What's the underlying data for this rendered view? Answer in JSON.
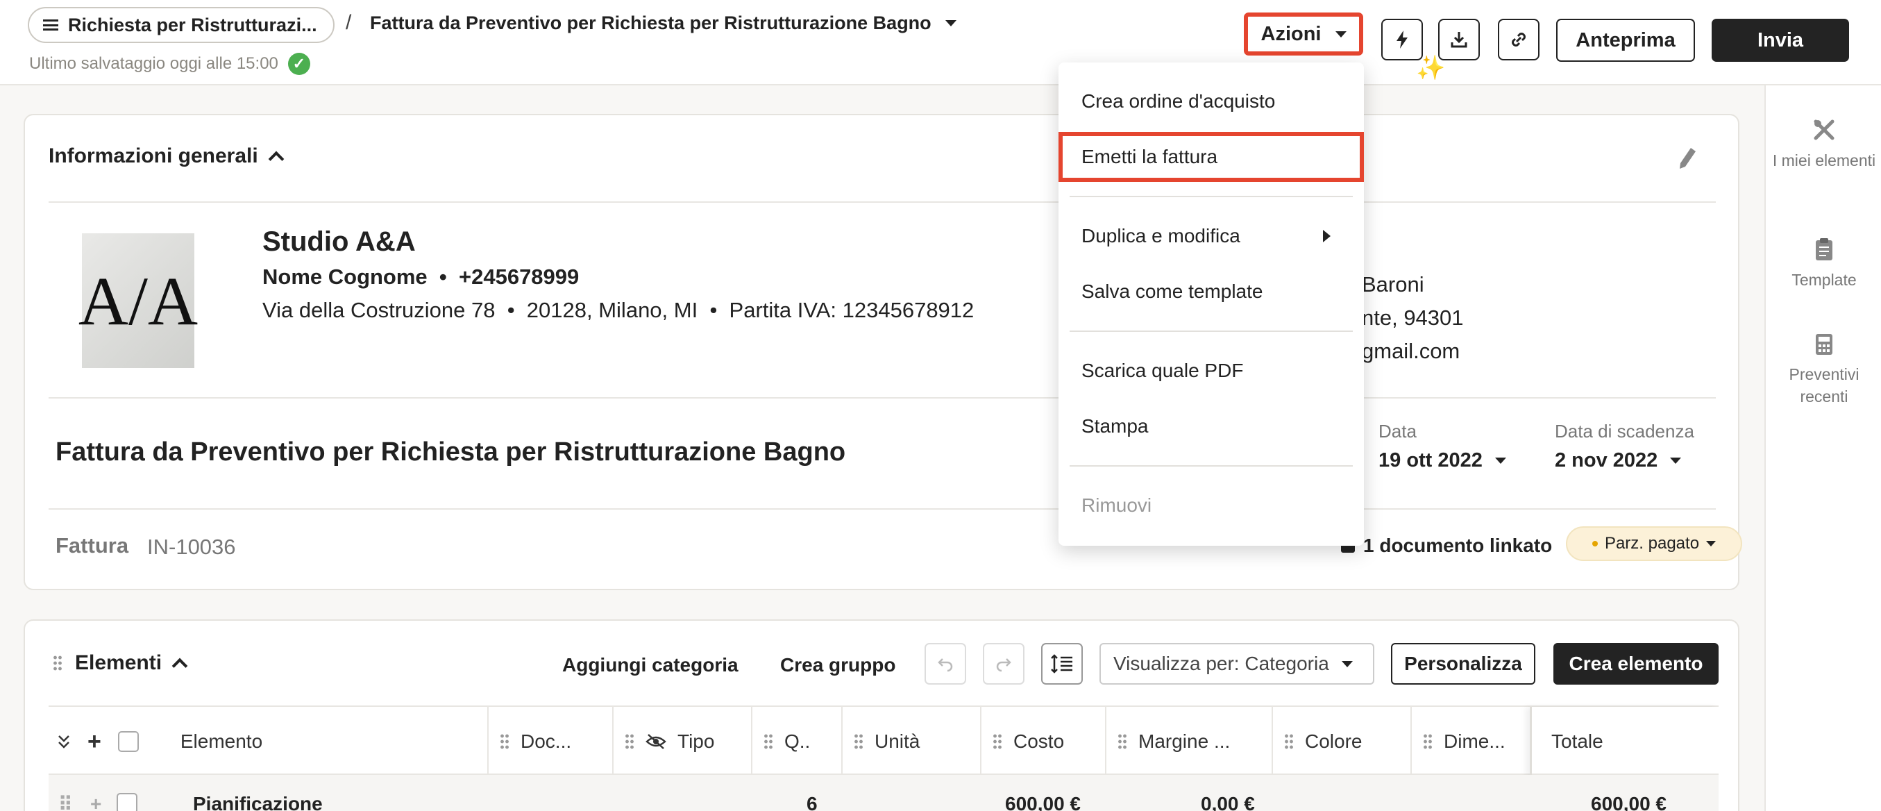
{
  "header": {
    "breadcrumb_parent": "Richiesta per Ristrutturazi...",
    "breadcrumb_sep": "/",
    "breadcrumb_current": "Fattura da Preventivo per Richiesta per Ristrutturazione Bagno",
    "save_status": "Ultimo salvataggio oggi alle 15:00",
    "azioni_label": "Azioni",
    "anteprima_label": "Anteprima",
    "invia_label": "Invia"
  },
  "menu": {
    "items": [
      {
        "label": "Crea ordine d'acquisto"
      },
      {
        "label": "Emetti la fattura"
      },
      {
        "label": "Duplica e modifica"
      },
      {
        "label": "Salva come template"
      },
      {
        "label": "Scarica quale PDF"
      },
      {
        "label": "Stampa"
      },
      {
        "label": "Rimuovi"
      }
    ]
  },
  "rail": {
    "items": [
      {
        "label": "I miei elementi",
        "icon": "tools-icon"
      },
      {
        "label": "Template",
        "icon": "clipboard-icon"
      },
      {
        "label": "Preventivi recenti",
        "icon": "calculator-icon"
      }
    ]
  },
  "info": {
    "section_title": "Informazioni generali",
    "company_name": "Studio A&A",
    "contact_name": "Nome Cognome",
    "contact_phone": "+245678999",
    "address_street": "Via della Costruzione 78",
    "address_city": "20128, Milano, MI",
    "vat": "Partita IVA: 12345678912",
    "client_line1": "Baroni",
    "client_line2": "nte, 94301",
    "client_line3": "gmail.com",
    "doc_title": "Fattura da Preventivo per Richiesta per Ristrutturazione Bagno",
    "date_label": "Data",
    "date_value": "19 ott 2022",
    "due_label": "Data di scadenza",
    "due_value": "2 nov 2022",
    "doc_type": "Fattura",
    "doc_number": "IN-10036",
    "linked_docs": "1 documento linkato",
    "status_badge": "Parz. pagato"
  },
  "elementi": {
    "section_title": "Elementi",
    "add_category": "Aggiungi categoria",
    "create_group": "Crea gruppo",
    "view_by": "Visualizza per: Categoria",
    "customize": "Personalizza",
    "create_element": "Crea elemento",
    "columns": [
      "Elemento",
      "Doc...",
      "Tipo",
      "Q..",
      "Unità",
      "Costo",
      "Margine ...",
      "Colore",
      "Dime...",
      "Totale"
    ],
    "rows": [
      {
        "name": "Pianificazione",
        "qty": "6",
        "cost": "600,00 €",
        "margin": "0,00 €",
        "total": "600,00 €"
      }
    ]
  }
}
